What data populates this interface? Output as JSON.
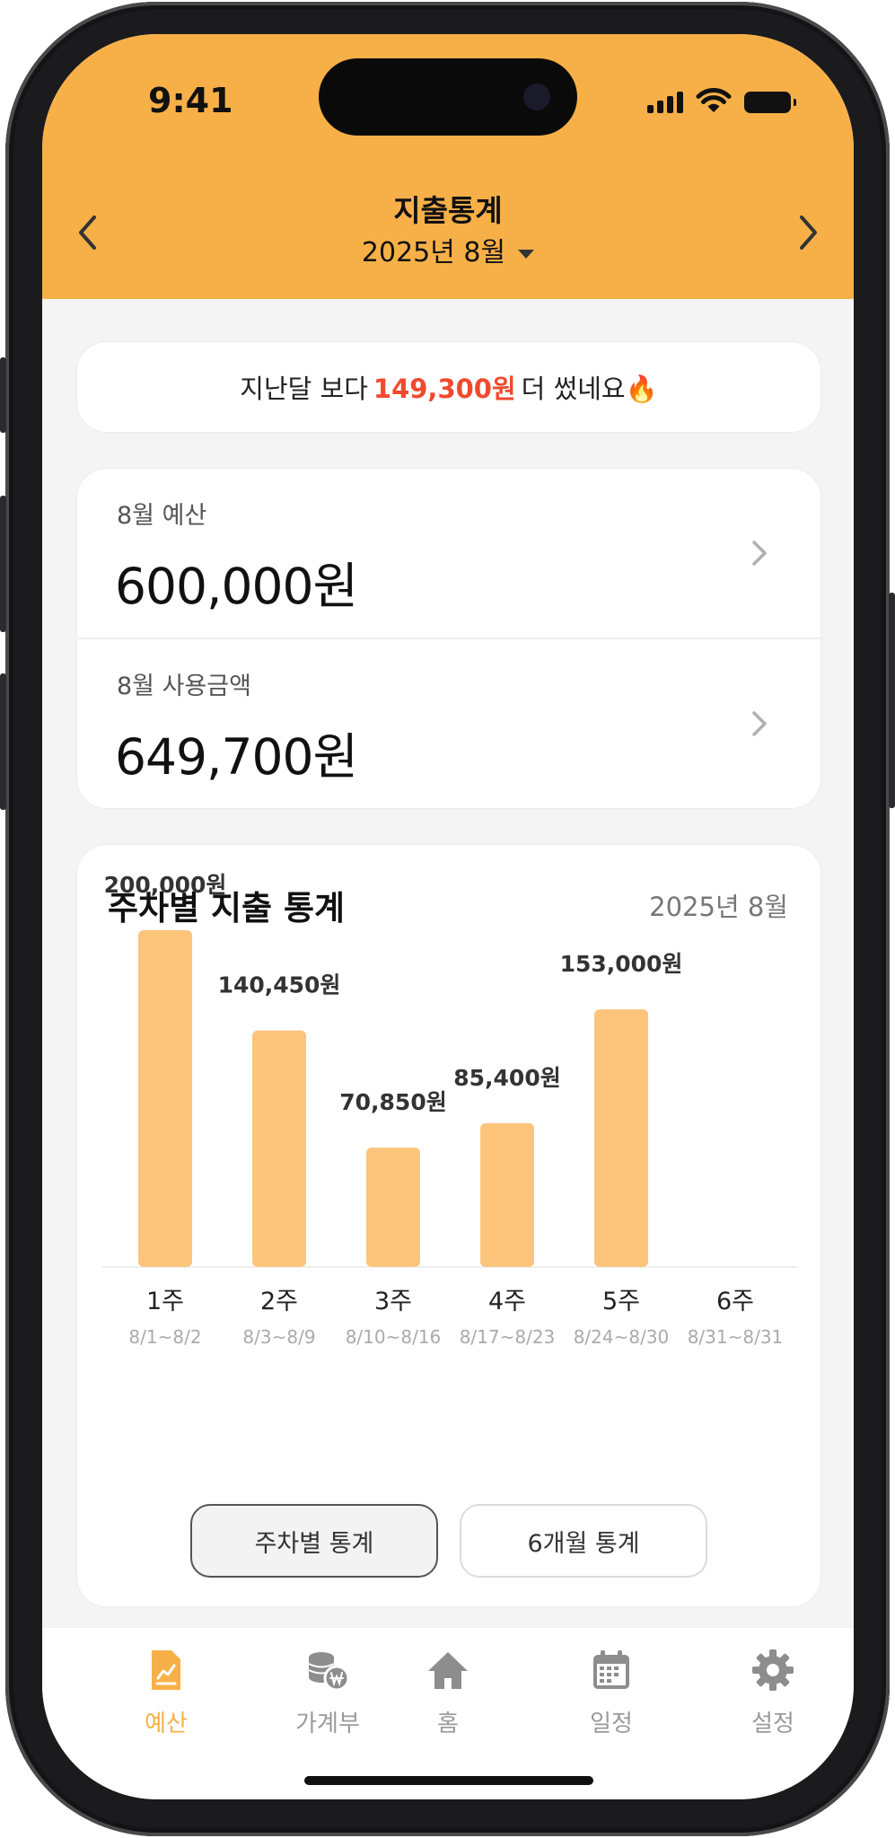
{
  "status_bar": {
    "time": "9:41"
  },
  "header": {
    "title": "지출통계",
    "month": "2025년 8월",
    "background": "#f7b048"
  },
  "notice": {
    "prefix": "지난달 보다",
    "amount": "149,300원",
    "suffix": "더 썼네요🔥",
    "amount_color": "#ef4a2f"
  },
  "budget": {
    "budget_label": "8월 예산",
    "budget_value": "600,000원",
    "used_label": "8월 사용금액",
    "used_value": "649,700원"
  },
  "weekly_stats": {
    "title": "주차별 지출 통계",
    "date": "2025년 8월"
  },
  "chart_data": {
    "type": "bar",
    "categories": [
      "1주",
      "2주",
      "3주",
      "4주",
      "5주",
      "6주"
    ],
    "ranges": [
      "8/1~8/2",
      "8/3~8/9",
      "8/10~8/16",
      "8/17~8/23",
      "8/24~8/30",
      "8/31~8/31"
    ],
    "values": [
      200000,
      140450,
      70850,
      85400,
      153000,
      0
    ],
    "value_labels": [
      "200,000원",
      "140,450원",
      "70,850원",
      "85,400원",
      "153,000원",
      ""
    ],
    "bar_color": "#fdc47c",
    "ylim": [
      0,
      200000
    ],
    "grid": false
  },
  "toggles": {
    "weekly": "주차별 통계",
    "monthly": "6개월 통계",
    "selected": "weekly"
  },
  "tabbar": {
    "items": [
      {
        "label": "예산",
        "icon": "budget-icon",
        "active": true
      },
      {
        "label": "가계부",
        "icon": "coins-icon",
        "active": false
      },
      {
        "label": "홈",
        "icon": "home-icon",
        "active": false
      },
      {
        "label": "일정",
        "icon": "calendar-icon",
        "active": false
      },
      {
        "label": "설정",
        "icon": "gear-icon",
        "active": false
      }
    ],
    "active_color": "#f7b048",
    "inactive_color": "#9a9a9a"
  }
}
